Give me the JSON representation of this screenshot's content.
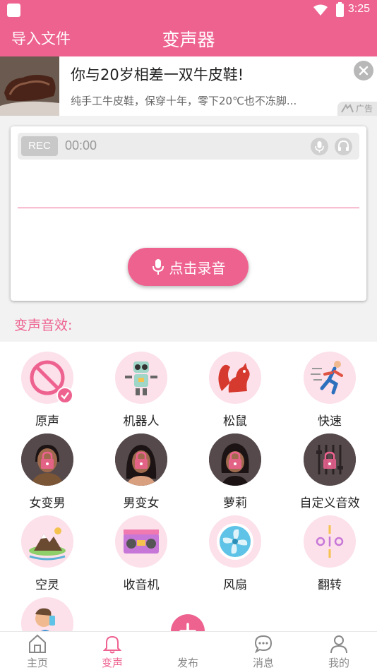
{
  "status": {
    "time": "3:25"
  },
  "header": {
    "import_label": "导入文件",
    "title": "变声器"
  },
  "ad": {
    "title": "你与20岁相差一双牛皮鞋!",
    "subtitle": "纯手工牛皮鞋，保穿十年，零下20℃也不冻脚...",
    "badge": "广告"
  },
  "recorder": {
    "rec_label": "REC",
    "time": "00:00",
    "record_button": "点击录音"
  },
  "effects": {
    "section_title": "变声音效:",
    "items": [
      {
        "label": "原声",
        "icon": "ban-icon",
        "selected": true
      },
      {
        "label": "机器人",
        "icon": "robot-icon"
      },
      {
        "label": "松鼠",
        "icon": "squirrel-icon"
      },
      {
        "label": "快速",
        "icon": "runner-icon"
      },
      {
        "label": "女变男",
        "icon": "man-locked-icon"
      },
      {
        "label": "男变女",
        "icon": "woman-locked-icon"
      },
      {
        "label": "萝莉",
        "icon": "girl-locked-icon"
      },
      {
        "label": "自定义音效",
        "icon": "equalizer-locked-icon"
      },
      {
        "label": "空灵",
        "icon": "mountain-icon"
      },
      {
        "label": "收音机",
        "icon": "radio-icon"
      },
      {
        "label": "风扇",
        "icon": "fan-icon"
      },
      {
        "label": "翻转",
        "icon": "flip-icon"
      },
      {
        "label": "",
        "icon": "drinking-man-icon"
      }
    ]
  },
  "tabs": [
    {
      "label": "主页",
      "icon": "home-icon"
    },
    {
      "label": "变声",
      "icon": "bell-icon",
      "active": true
    },
    {
      "label": "发布",
      "icon": "plus-icon"
    },
    {
      "label": "消息",
      "icon": "chat-icon"
    },
    {
      "label": "我的",
      "icon": "user-icon"
    }
  ],
  "colors": {
    "accent": "#ee6290",
    "circle_pink": "#fce0ea",
    "locked_dark": "#55494b"
  }
}
